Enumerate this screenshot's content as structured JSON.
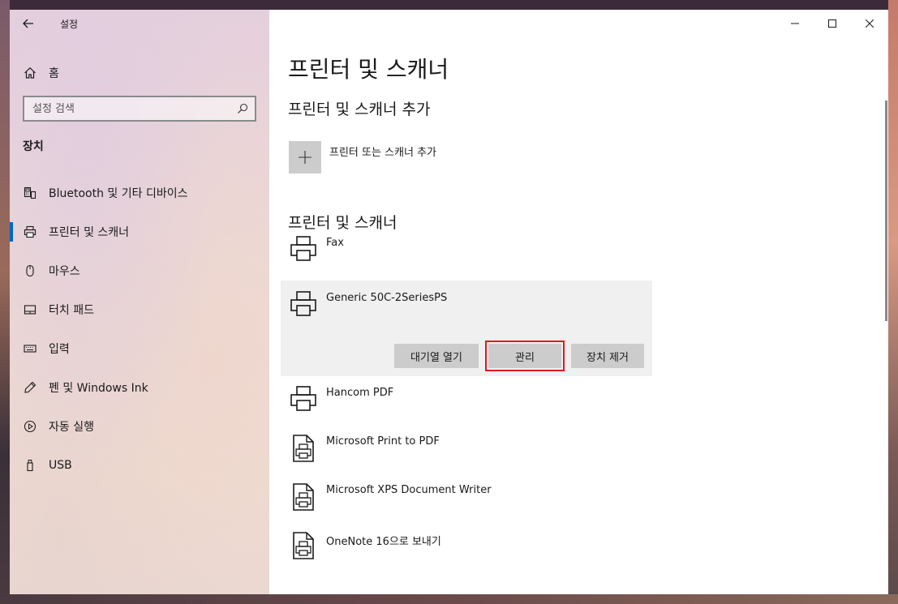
{
  "window": {
    "title": "설정"
  },
  "sidebar": {
    "home_label": "홈",
    "search_placeholder": "설정 검색",
    "section_title": "장치",
    "items": [
      {
        "label": "Bluetooth 및 기타 디바이스",
        "icon": "bluetooth-devices-icon"
      },
      {
        "label": "프린터 및 스캐너",
        "icon": "printer-icon",
        "selected": true
      },
      {
        "label": "마우스",
        "icon": "mouse-icon"
      },
      {
        "label": "터치 패드",
        "icon": "touchpad-icon"
      },
      {
        "label": "입력",
        "icon": "keyboard-icon"
      },
      {
        "label": "펜 및 Windows Ink",
        "icon": "pen-icon"
      },
      {
        "label": "자동 실행",
        "icon": "autoplay-icon"
      },
      {
        "label": "USB",
        "icon": "usb-icon"
      }
    ]
  },
  "main": {
    "page_title": "프린터 및 스캐너",
    "add_section_heading": "프린터 및 스캐너 추가",
    "add_button_label": "프린터 또는 스캐너 추가",
    "list_heading": "프린터 및 스캐너",
    "devices": [
      {
        "name": "Fax",
        "icon": "printer-icon"
      },
      {
        "name": "Generic 50C-2SeriesPS",
        "icon": "printer-icon",
        "expanded": true
      },
      {
        "name": "Hancom PDF",
        "icon": "printer-icon"
      },
      {
        "name": "Microsoft Print to PDF",
        "icon": "document-printer-icon"
      },
      {
        "name": "Microsoft XPS Document Writer",
        "icon": "document-printer-icon"
      },
      {
        "name": "OneNote 16으로 보내기",
        "icon": "document-printer-icon"
      }
    ],
    "actions": {
      "open_queue": "대기열 열기",
      "manage": "관리",
      "remove": "장치 제거"
    }
  },
  "colors": {
    "accent": "#0067c0",
    "highlight": "#e0191e",
    "button_bg": "#cccccc"
  }
}
